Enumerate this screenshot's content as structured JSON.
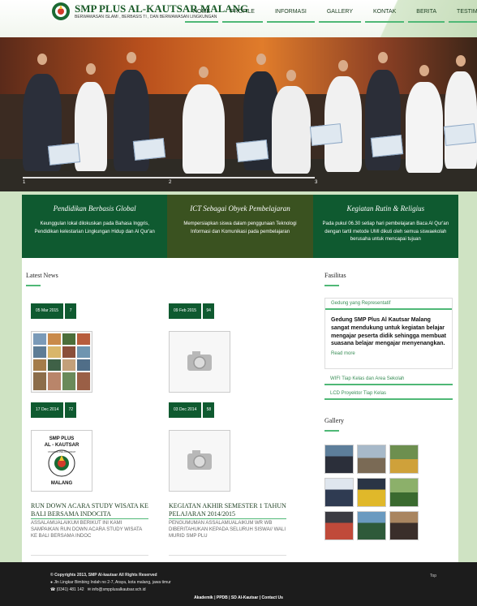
{
  "header": {
    "brand": "SMP PLUS AL-KAUTSAR MALANG",
    "tagline": "BERWAWASAN ISLAMI , BERBASIS TI , DAN BERWAWASAN LINGKUNGAN"
  },
  "nav": [
    "HOME",
    "PROFILE",
    "INFORMASI",
    "GALLERY",
    "KONTAK",
    "BERITA",
    "TESTIMONI"
  ],
  "slider": {
    "numbers": [
      "1",
      "2",
      "3"
    ]
  },
  "features": [
    {
      "title": "Pendidikan Berbasis Global",
      "text": "Keunggulan lokal dilokuskan pada Bahasa Inggris, Pendidikan kelestarian Lingkungan Hidup dan Al Qur'an"
    },
    {
      "title": "ICT Sebagai Obyek Pembelajaran",
      "text": "Mempersiapkan siswa dalam penggunaan Teknologi Informasi dan Komunikasi pada pembelajaran"
    },
    {
      "title": "Kegiatan Rutin & Religius",
      "text": "Pada pukul 06.30 setiap hari pembelajaran Baca Al Qur'an dengan tartil metode UMI dikuti oleh semua siswaekolah berusaha untuk mencapai tujuan"
    }
  ],
  "latest_news": {
    "title": "Latest News",
    "posts": [
      {
        "date": "05 Mar 2015",
        "count": "7"
      },
      {
        "date": "09 Feb 2015",
        "count": "94"
      },
      {
        "date": "17 Dec 2014",
        "count": "72",
        "title": "RUN DOWN ACARA STUDY WISATA KE BALI BERSAMA INDOCITA",
        "excerpt": "ASSALAMUALAIKUM BERIKUT INI KAMI SAMPAIKAN RUN DOWN ACARA STUDY WISATA KE BALI BERSAMA INDOC"
      },
      {
        "date": "03 Dec 2014",
        "count": "58",
        "title": "KEGIATAN AKHIR SEMESTER 1 TAHUN PELAJARAN 2014/2015",
        "excerpt": "PENGUMUMAN ASSALAMUALAIKUM WR WB DIBERITAHUKAN KEPADA SELURUH SISWA// WALI MURID SMP PLU"
      }
    ],
    "logo_text": {
      "top": "SMP PLUS",
      "middle": "AL - KAUTSAR",
      "ring": "YAYASAN PELITA HIDUP",
      "bottom": "MALANG"
    }
  },
  "fasilitas": {
    "title": "Fasilitas",
    "open_item": "Gedung yang Representatif",
    "body": "Gedung SMP Plus Al Kautsar Malang sangat mendukung untuk kegiatan belajar mengajar peserta didik sehingga membuat suasana belajar mengajar menyenangkan.",
    "read_more": "Read more",
    "items": [
      "WIFI Tiap Kelas dan Area Sekolah",
      "LCD Proyektor Tiap Kelas"
    ]
  },
  "gallery": {
    "title": "Gallery"
  },
  "footer": {
    "copyright": "© Copyrights 2013, SMP Al-kautsar All Rights Reserved",
    "address": "Jln Lingkar Bimbing Indah no 2-7, Araya, kota malang, jawa timur",
    "phone": "(0341) 481 142",
    "email": "info@smpplusalkautsar.sch.id",
    "top": "Top",
    "links": "Akademik | PPDB | SD Al-Kautsar | Contact Us"
  },
  "colors": {
    "primary": "#0f5a30",
    "olive": "#3a5220",
    "accent": "#4fb876",
    "page_bg": "#cfe3c3"
  }
}
